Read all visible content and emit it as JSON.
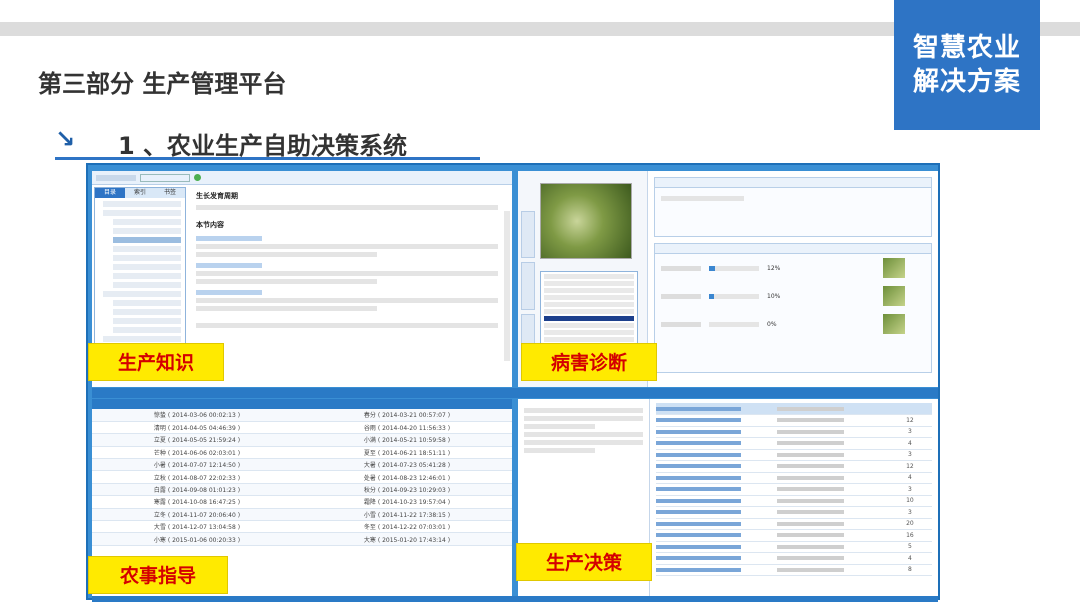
{
  "brand": {
    "line1": "智慧农业",
    "line2": "解决方案"
  },
  "page": {
    "title": "第三部分  生产管理平台",
    "section_title": "1 、农业生产自助决策系统"
  },
  "labels": {
    "knowledge": "生产知识",
    "disease": "病害诊断",
    "farming": "农事指导",
    "decision": "生产决策"
  },
  "knowledge": {
    "heading": "生长发育周期",
    "subheading": "本节内容",
    "tabs": [
      "目录",
      "索引",
      "书签"
    ]
  },
  "farming_rows": [
    [
      "惊蛰 ( 2014-03-06 00:02:13 )",
      "春分 ( 2014-03-21 00:57:07 )"
    ],
    [
      "清明 ( 2014-04-05 04:46:39 )",
      "谷雨 ( 2014-04-20 11:56:33 )"
    ],
    [
      "立夏 ( 2014-05-05 21:59:24 )",
      "小满 ( 2014-05-21 10:59:58 )"
    ],
    [
      "芒种 ( 2014-06-06 02:03:01 )",
      "夏至 ( 2014-06-21 18:51:11 )"
    ],
    [
      "小暑 ( 2014-07-07 12:14:50 )",
      "大暑 ( 2014-07-23 05:41:28 )"
    ],
    [
      "立秋 ( 2014-08-07 22:02:33 )",
      "处暑 ( 2014-08-23 12:46:01 )"
    ],
    [
      "白露 ( 2014-09-08 01:01:23 )",
      "秋分 ( 2014-09-23 10:29:03 )"
    ],
    [
      "寒露 ( 2014-10-08 16:47:25 )",
      "霜降 ( 2014-10-23 19:57:04 )"
    ],
    [
      "立冬 ( 2014-11-07 20:06:40 )",
      "小雪 ( 2014-11-22 17:38:15 )"
    ],
    [
      "大雪 ( 2014-12-07 13:04:58 )",
      "冬至 ( 2014-12-22 07:03:01 )"
    ],
    [
      "小寒 ( 2015-01-06 00:20:33 )",
      "大寒 ( 2015-01-20 17:43:14 )"
    ]
  ],
  "decision_counts": [
    "",
    "12",
    "3",
    "4",
    "3",
    "12",
    "4",
    "3",
    "10",
    "3",
    "20",
    "16",
    "5",
    "4",
    "8"
  ],
  "disease_percents": [
    "12%",
    "10%",
    "0%"
  ]
}
